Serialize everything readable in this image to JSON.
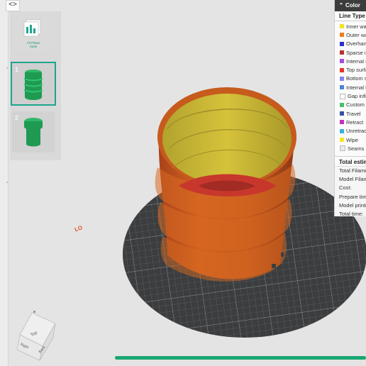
{
  "sidebar": {
    "toggle_icon": "collapse-icon",
    "plates": [
      {
        "label": "All Plates\nStats",
        "icon": "all-plates-stats-icon"
      },
      {
        "number": "1",
        "selected": true
      },
      {
        "number": "2",
        "selected": false
      }
    ]
  },
  "viewport": {
    "plate_label": "LO",
    "view_cube": {
      "top": "Top",
      "left": "Right",
      "right": "Back"
    }
  },
  "color_panel": {
    "title": "Color",
    "line_type_header": "Line Type",
    "legend": [
      {
        "label": "Inner wall",
        "color": "#f2e21f"
      },
      {
        "label": "Outer wall",
        "color": "#f07c1b"
      },
      {
        "label": "Overhang wall",
        "color": "#2c2fc9"
      },
      {
        "label": "Sparse infill",
        "color": "#b8332b"
      },
      {
        "label": "Internal solid infill",
        "color": "#a44be0"
      },
      {
        "label": "Top surface",
        "color": "#e6342d"
      },
      {
        "label": "Bottom surface",
        "color": "#7f87e8"
      },
      {
        "label": "Internal Bridge",
        "color": "#4a84d7"
      },
      {
        "label": "Gap infill",
        "color": "#ffffff"
      },
      {
        "label": "Custom",
        "color": "#45c06b"
      },
      {
        "label": "Travel",
        "color": "#3b4fa8"
      },
      {
        "label": "Retract",
        "color": "#c12fc1"
      },
      {
        "label": "Unretract",
        "color": "#36b3d6"
      },
      {
        "label": "Wipe",
        "color": "#f3e81e"
      },
      {
        "label": "Seams",
        "color": "#e8e8e8"
      }
    ],
    "totals_header": "Total estimation",
    "stats": [
      "Total Filament:",
      "Model Filament:",
      "Cost:",
      "Prepare time:",
      "Model printing time:",
      "Total time:"
    ]
  },
  "progress": {
    "fraction": 1.0,
    "color": "#1aa673"
  }
}
